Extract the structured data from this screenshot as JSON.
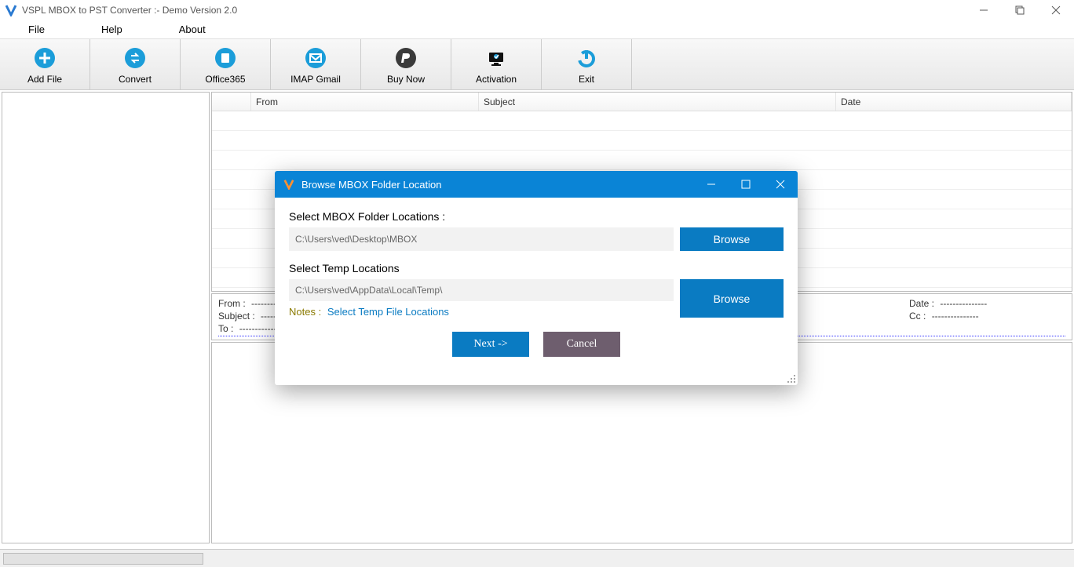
{
  "titlebar": {
    "app_title": "VSPL MBOX to PST Converter  :- Demo Version 2.0"
  },
  "menubar": {
    "file": "File",
    "help": "Help",
    "about": "About"
  },
  "toolbar": {
    "add_file": "Add File",
    "convert": "Convert",
    "office365": "Office365",
    "imap_gmail": "IMAP Gmail",
    "buy_now": "Buy Now",
    "activation": "Activation",
    "exit": "Exit"
  },
  "grid": {
    "headers": {
      "from": "From",
      "subject": "Subject",
      "date": "Date"
    }
  },
  "details": {
    "from_label": "From :",
    "subject_label": "Subject :",
    "to_label": "To :",
    "date_label": "Date :",
    "cc_label": "Cc :",
    "dash": "---------------"
  },
  "dialog": {
    "title": "Browse MBOX Folder Location",
    "select_mbox_label": "Select MBOX Folder Locations :",
    "mbox_path": "C:\\Users\\ved\\Desktop\\MBOX",
    "browse_label": "Browse",
    "select_temp_label": "Select Temp Locations",
    "temp_path": "C:\\Users\\ved\\AppData\\Local\\Temp\\",
    "notes_label": "Notes :",
    "notes_link": "Select Temp File Locations",
    "next_label": "Next  ->",
    "cancel_label": "Cancel"
  }
}
